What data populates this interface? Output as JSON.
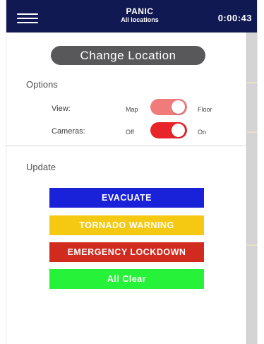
{
  "header": {
    "title": "PANIC",
    "subtitle": "All locations",
    "timer": "0:00:43",
    "background": "#111952"
  },
  "drawer": {
    "change_location_label": "Change Location",
    "options_heading": "Options",
    "view": {
      "label": "View:",
      "off_text": "Map",
      "on_text": "Floor",
      "state": "on",
      "color": "#f07b7b"
    },
    "cameras": {
      "label": "Cameras:",
      "off_text": "Off",
      "on_text": "On",
      "state": "on",
      "color": "#e8232a"
    },
    "update_heading": "Update",
    "actions": [
      {
        "label": "EVACUATE",
        "color": "#1a22d9"
      },
      {
        "label": "TORNADO WARNING",
        "color": "#f5c811"
      },
      {
        "label": "EMERGENCY LOCKDOWN",
        "color": "#d12b1f"
      },
      {
        "label": "All Clear",
        "color": "#27f23a"
      }
    ]
  },
  "icons": {
    "menu": "hamburger-menu-icon"
  }
}
